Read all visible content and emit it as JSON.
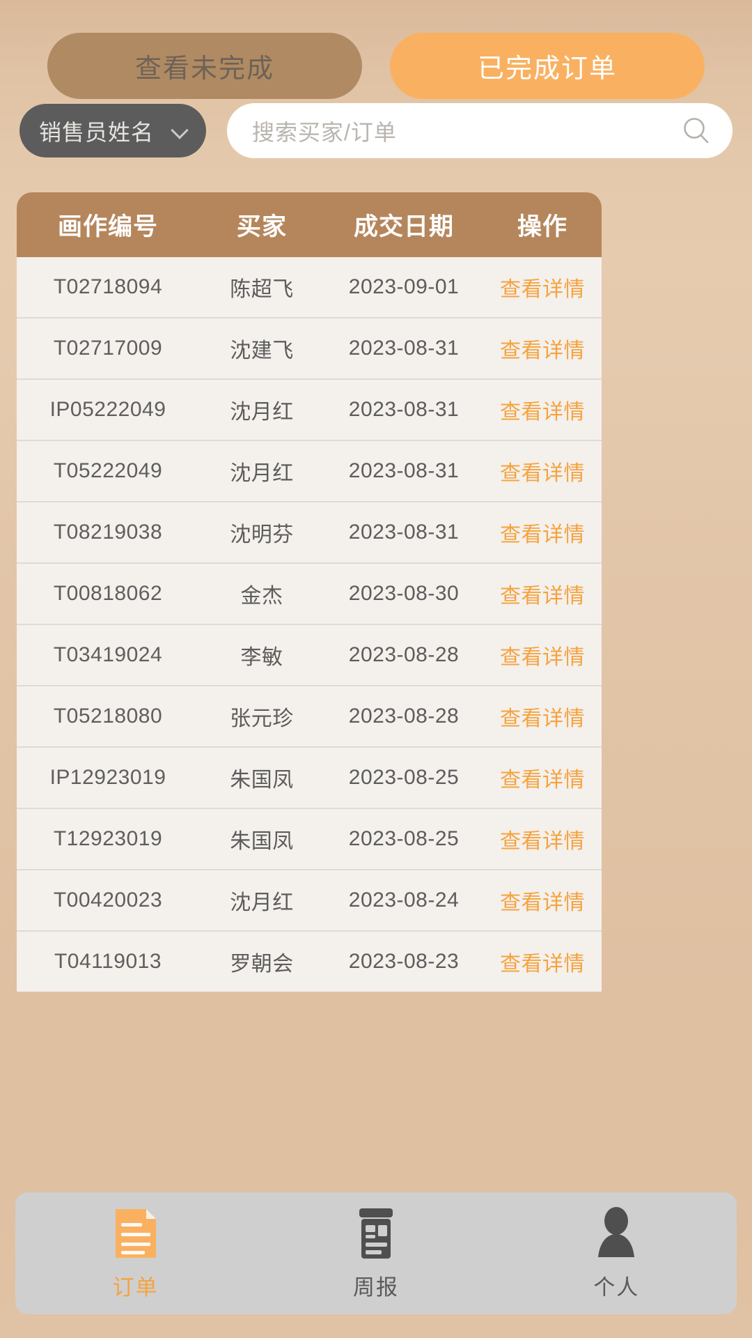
{
  "tabs": [
    {
      "label": "查看未完成",
      "state": "inactive"
    },
    {
      "label": "已完成订单",
      "state": "active"
    }
  ],
  "filter": {
    "seller_select_label": "销售员姓名",
    "chevron_icon": "chevron-down-icon",
    "search_placeholder": "搜索买家/订单",
    "search_value": "",
    "search_icon": "search-icon"
  },
  "table": {
    "columns": [
      "画作编号",
      "买家",
      "成交日期",
      "操作"
    ],
    "action_label": "查看详情",
    "rows": [
      {
        "code": "T02718094",
        "buyer": "陈超飞",
        "date": "2023-09-01",
        "action": "查看详情"
      },
      {
        "code": "T02717009",
        "buyer": "沈建飞",
        "date": "2023-08-31",
        "action": "查看详情"
      },
      {
        "code": "IP05222049",
        "buyer": "沈月红",
        "date": "2023-08-31",
        "action": "查看详情"
      },
      {
        "code": "T05222049",
        "buyer": "沈月红",
        "date": "2023-08-31",
        "action": "查看详情"
      },
      {
        "code": "T08219038",
        "buyer": "沈明芬",
        "date": "2023-08-31",
        "action": "查看详情"
      },
      {
        "code": "T00818062",
        "buyer": "金杰",
        "date": "2023-08-30",
        "action": "查看详情"
      },
      {
        "code": "T03419024",
        "buyer": "李敏",
        "date": "2023-08-28",
        "action": "查看详情"
      },
      {
        "code": "T05218080",
        "buyer": "张元珍",
        "date": "2023-08-28",
        "action": "查看详情"
      },
      {
        "code": "IP12923019",
        "buyer": "朱国凤",
        "date": "2023-08-25",
        "action": "查看详情"
      },
      {
        "code": "T12923019",
        "buyer": "朱国凤",
        "date": "2023-08-25",
        "action": "查看详情"
      },
      {
        "code": "T00420023",
        "buyer": "沈月红",
        "date": "2023-08-24",
        "action": "查看详情"
      },
      {
        "code": "T04119013",
        "buyer": "罗朝会",
        "date": "2023-08-23",
        "action": "查看详情"
      }
    ]
  },
  "bottom_nav": {
    "items": [
      {
        "label": "订单",
        "icon": "document-icon",
        "state": "active"
      },
      {
        "label": "周报",
        "icon": "report-icon",
        "state": "inactive"
      },
      {
        "label": "个人",
        "icon": "person-icon",
        "state": "inactive"
      }
    ]
  },
  "colors": {
    "accent_orange": "#f9b161",
    "link_orange": "#f5a33f",
    "tab_inactive_brown": "#b08a62",
    "table_header_brown": "#b5865c",
    "row_background": "#f4f0ec",
    "select_dark": "#5c5c5c",
    "nav_background": "#cfcfcf",
    "page_background": "#e2c5a8"
  }
}
